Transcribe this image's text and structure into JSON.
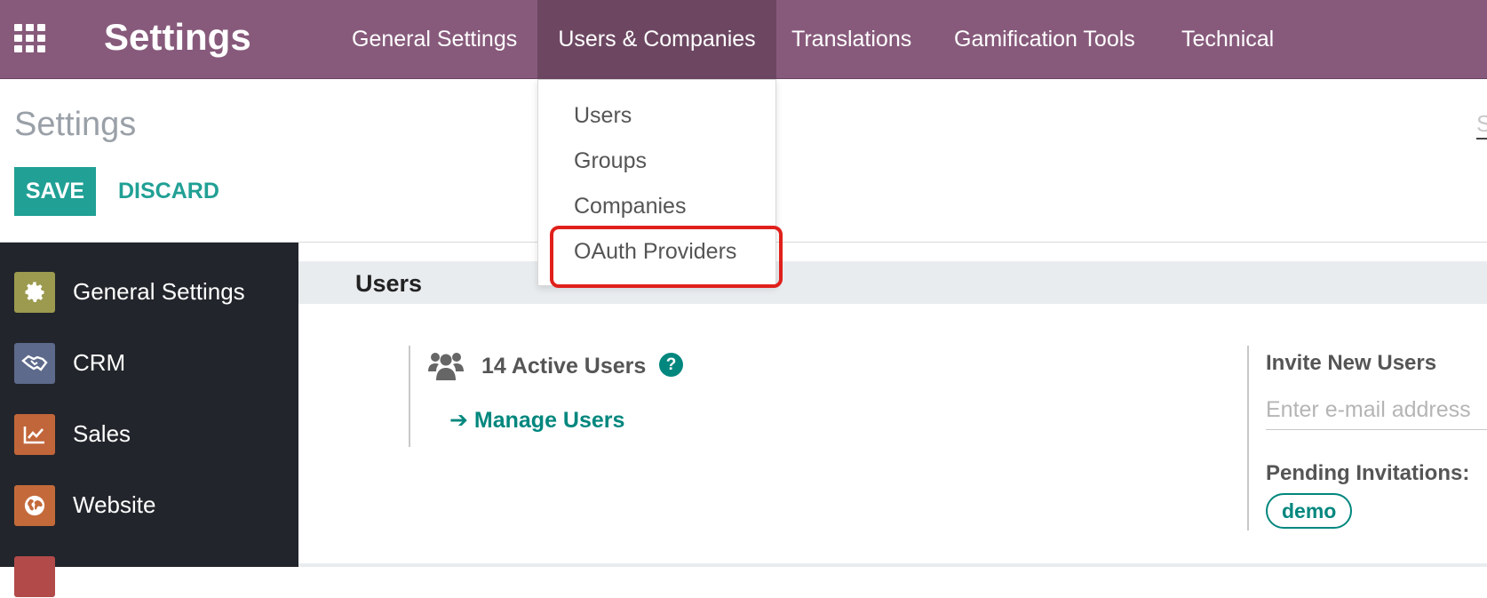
{
  "app": {
    "title": "Settings"
  },
  "nav": {
    "items": [
      {
        "label": "General Settings"
      },
      {
        "label": "Users & Companies"
      },
      {
        "label": "Translations"
      },
      {
        "label": "Gamification Tools"
      },
      {
        "label": "Technical"
      }
    ],
    "active_index": 1
  },
  "dropdown": {
    "items": [
      {
        "label": "Users"
      },
      {
        "label": "Groups"
      },
      {
        "label": "Companies"
      },
      {
        "label": "OAuth Providers"
      }
    ],
    "highlighted_index": 3
  },
  "control_panel": {
    "breadcrumb": "Settings",
    "save_label": "SAVE",
    "discard_label": "DISCARD",
    "search_peek": "S"
  },
  "sidebar": {
    "items": [
      {
        "label": "General Settings",
        "icon": "gear-icon",
        "color": "#9b9a4f"
      },
      {
        "label": "CRM",
        "icon": "handshake-icon",
        "color": "#5e6a8c"
      },
      {
        "label": "Sales",
        "icon": "chart-line-icon",
        "color": "#c1663a"
      },
      {
        "label": "Website",
        "icon": "globe-icon",
        "color": "#c46a3a"
      },
      {
        "label": "",
        "icon": "app-icon",
        "color": "#b34a4a"
      }
    ]
  },
  "users_section": {
    "title": "Users",
    "active_users": "14 Active Users",
    "help": "?",
    "manage_users": "Manage Users",
    "invite_title": "Invite New Users",
    "invite_placeholder": "Enter e-mail address",
    "pending_title": "Pending Invitations:",
    "pending_tag": "demo"
  },
  "colors": {
    "topbar": "#875a7b",
    "accent": "#21a095",
    "link": "#01877e",
    "highlight": "#e0201b",
    "sidebar": "#22252b"
  }
}
